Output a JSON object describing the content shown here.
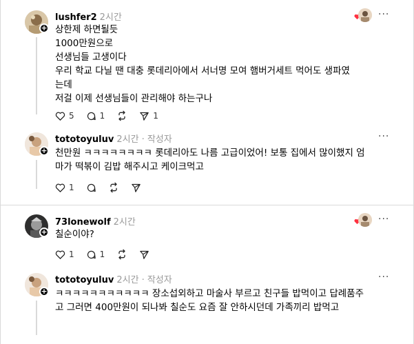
{
  "posts": [
    {
      "username": "lushfer2",
      "time": "2시간",
      "author_tag": "",
      "lines": [
        "상한제 하면될듯",
        "1000만원으로",
        "선생님들 고생이다",
        "우리 학교 다닐 땐 대충 롯데리아에서 서너명 모여 햄버거세트 먹어도 생파였",
        "는데",
        "저걸 이제 선생님들이 관리해야 하는구나"
      ],
      "likes": "5",
      "comments": "1",
      "reposts": "",
      "shares": "1"
    },
    {
      "username": "tototoyuluv",
      "time": "2시간",
      "author_tag": "· 작성자",
      "lines": [
        "천만원 ㅋㅋㅋㅋㅋㅋㅋㅋ 롯데리아도 나름 고급이었어! 보통 집에서 많이했지 엄",
        "마가 떡볶이 김밥 해주시고 케이크먹고"
      ],
      "likes": "1",
      "comments": "",
      "reposts": "",
      "shares": ""
    },
    {
      "username": "73lonewolf",
      "time": "2시간",
      "author_tag": "",
      "lines": [
        "칠순이야?"
      ],
      "likes": "1",
      "comments": "1",
      "reposts": "",
      "shares": ""
    },
    {
      "username": "tototoyuluv",
      "time": "2시간",
      "author_tag": "· 작성자",
      "lines": [
        "ㅋㅋㅋㅋㅋㅋㅋㅋㅋㅋㅋ 장소섭외하고 마술사 부르고 친구들 밥먹이고 답례품주",
        "고 그러면 400만원이 되나봐 칠순도 요즘 잘 안하시던데 가족끼리 밥먹고"
      ],
      "likes": "",
      "comments": "",
      "reposts": "",
      "shares": ""
    }
  ],
  "more_label": "···",
  "accent": "#ff3040"
}
